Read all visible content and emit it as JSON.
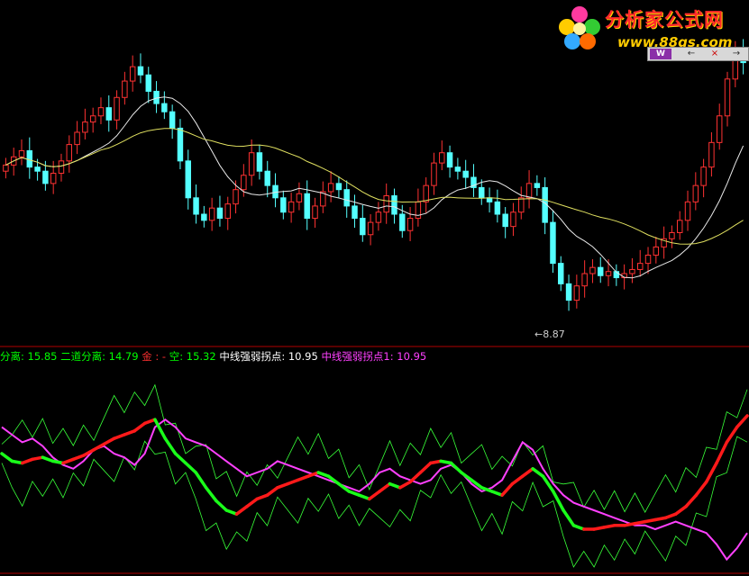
{
  "watermark": {
    "title": "分析家公式网",
    "url": "www.88gs.com"
  },
  "toolbar": {
    "logo": "W",
    "btn1": "←",
    "btn2": "×",
    "btn3": "→"
  },
  "price_annotation": "←8.87",
  "legend": [
    {
      "text": "分离: 15.85",
      "color": "#00ff00"
    },
    {
      "text": "二道分离: 14.79",
      "color": "#00ff00"
    },
    {
      "text": "金",
      "color": "#ff3030"
    },
    {
      "text": "空: 15.32",
      "color": "#00ff00"
    },
    {
      "text": "中线强弱拐点: 10.95",
      "color": "#ffffff"
    },
    {
      "text": "中线强弱拐点1: 10.95",
      "color": "#ff40ff"
    }
  ],
  "legend_sep": ": - ",
  "colors": {
    "up": "#ff3232",
    "down": "#54ffff",
    "ma_short": "#e8e8e8",
    "ma_long": "#e0e060",
    "divider": "#b00000",
    "osc_red": "#ff1a1a",
    "osc_green": "#1aff1a",
    "osc_magenta": "#ff40ff",
    "osc_thin": "#38ff38"
  },
  "chart_data": [
    {
      "type": "candlestick",
      "title": "",
      "min_label": 8.87,
      "closes": [
        16.2,
        16.6,
        16.9,
        16.1,
        15.9,
        15.3,
        15.8,
        16.4,
        17.2,
        17.8,
        18.3,
        18.6,
        19.0,
        18.4,
        19.5,
        20.3,
        21.0,
        20.6,
        19.8,
        19.2,
        18.8,
        18.0,
        16.4,
        14.6,
        13.8,
        13.5,
        14.1,
        13.6,
        14.3,
        15.0,
        15.7,
        16.8,
        15.9,
        15.2,
        14.6,
        13.9,
        14.4,
        14.8,
        13.6,
        14.2,
        14.9,
        15.3,
        15.0,
        14.2,
        13.6,
        12.8,
        13.4,
        13.9,
        14.7,
        13.8,
        13.0,
        13.6,
        14.4,
        15.2,
        16.3,
        16.8,
        16.1,
        15.9,
        15.6,
        15.1,
        14.6,
        14.4,
        13.8,
        13.2,
        13.9,
        14.6,
        15.3,
        15.1,
        13.4,
        11.4,
        10.4,
        9.6,
        10.3,
        10.9,
        11.2,
        10.8,
        11.0,
        10.7,
        10.9,
        11.1,
        11.4,
        11.8,
        12.2,
        12.6,
        12.9,
        13.5,
        14.4,
        15.2,
        16.1,
        17.3,
        18.6,
        20.4,
        21.8,
        21.2
      ]
    },
    {
      "type": "line",
      "title": "",
      "series": [
        {
          "values": [
            0.6,
            0.56,
            0.55,
            0.57,
            0.58,
            0.56,
            0.55,
            0.57,
            0.59,
            0.62,
            0.65,
            0.68,
            0.7,
            0.72,
            0.76,
            0.78,
            0.68,
            0.6,
            0.55,
            0.5,
            0.42,
            0.35,
            0.3,
            0.28,
            0.32,
            0.36,
            0.38,
            0.42,
            0.44,
            0.46,
            0.48,
            0.5,
            0.48,
            0.44,
            0.4,
            0.38,
            0.36,
            0.4,
            0.44,
            0.42,
            0.45,
            0.5,
            0.55,
            0.56,
            0.55,
            0.5,
            0.46,
            0.42,
            0.4,
            0.38,
            0.44,
            0.48,
            0.52,
            0.48,
            0.4,
            0.3,
            0.22,
            0.2,
            0.2,
            0.21,
            0.22,
            0.22,
            0.23,
            0.24,
            0.25,
            0.26,
            0.28,
            0.32,
            0.38,
            0.45,
            0.55,
            0.66,
            0.74,
            0.8
          ]
        },
        {
          "values": [
            0.74,
            0.7,
            0.66,
            0.68,
            0.64,
            0.58,
            0.54,
            0.52,
            0.56,
            0.62,
            0.64,
            0.6,
            0.58,
            0.54,
            0.6,
            0.74,
            0.78,
            0.74,
            0.68,
            0.66,
            0.64,
            0.6,
            0.56,
            0.52,
            0.48,
            0.5,
            0.52,
            0.56,
            0.54,
            0.52,
            0.5,
            0.48,
            0.46,
            0.44,
            0.42,
            0.4,
            0.44,
            0.5,
            0.52,
            0.48,
            0.46,
            0.44,
            0.46,
            0.52,
            0.54,
            0.5,
            0.44,
            0.4,
            0.42,
            0.46,
            0.56,
            0.66,
            0.62,
            0.52,
            0.44,
            0.38,
            0.34,
            0.32,
            0.3,
            0.28,
            0.26,
            0.24,
            0.22,
            0.22,
            0.2,
            0.22,
            0.24,
            0.22,
            0.2,
            0.18,
            0.12,
            0.04,
            0.1,
            0.18
          ]
        }
      ]
    }
  ]
}
